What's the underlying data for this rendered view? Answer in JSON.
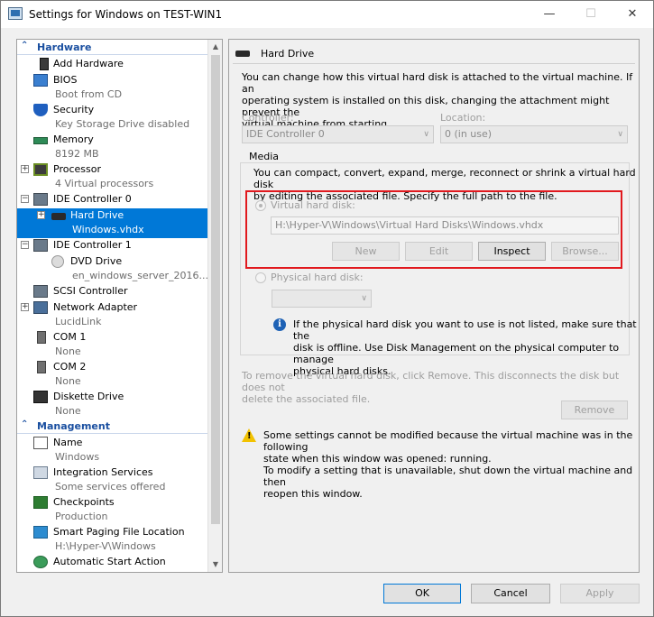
{
  "window": {
    "title": "Settings for Windows on TEST-WIN1",
    "minimize": "—",
    "maximize": "☐",
    "close": "✕"
  },
  "sidebar": {
    "hardware_label": "Hardware",
    "management_label": "Management",
    "items": [
      {
        "name": "Add Hardware",
        "sub": ""
      },
      {
        "name": "BIOS",
        "sub": "Boot from CD"
      },
      {
        "name": "Security",
        "sub": "Key Storage Drive disabled"
      },
      {
        "name": "Memory",
        "sub": "8192 MB"
      },
      {
        "name": "Processor",
        "sub": "4 Virtual processors"
      },
      {
        "name": "IDE Controller 0",
        "sub": ""
      },
      {
        "name": "Hard Drive",
        "sub": "Windows.vhdx"
      },
      {
        "name": "IDE Controller 1",
        "sub": ""
      },
      {
        "name": "DVD Drive",
        "sub": "en_windows_server_2016..."
      },
      {
        "name": "SCSI Controller",
        "sub": ""
      },
      {
        "name": "Network Adapter",
        "sub": "LucidLink"
      },
      {
        "name": "COM 1",
        "sub": "None"
      },
      {
        "name": "COM 2",
        "sub": "None"
      },
      {
        "name": "Diskette Drive",
        "sub": "None"
      }
    ],
    "management_items": [
      {
        "name": "Name",
        "sub": "Windows"
      },
      {
        "name": "Integration Services",
        "sub": "Some services offered"
      },
      {
        "name": "Checkpoints",
        "sub": "Production"
      },
      {
        "name": "Smart Paging File Location",
        "sub": "H:\\Hyper-V\\Windows"
      },
      {
        "name": "Automatic Start Action",
        "sub": ""
      }
    ]
  },
  "main": {
    "header": "Hard Drive",
    "intro": [
      "You can change how this virtual hard disk is attached to the virtual machine. If an",
      "operating system is installed on this disk, changing the attachment might prevent the",
      "virtual machine from starting."
    ],
    "controller_label": "Controller:",
    "controller_value": "IDE Controller 0",
    "location_label": "Location:",
    "location_value": "0 (in use)",
    "media_label": "Media",
    "media_desc": [
      "You can compact, convert, expand, merge, reconnect or shrink a virtual hard disk",
      "by editing the associated file. Specify the full path to the file."
    ],
    "vhd_label": "Virtual hard disk:",
    "vhd_path": "H:\\Hyper-V\\Windows\\Virtual Hard Disks\\Windows.vhdx",
    "new_label": "New",
    "edit_label": "Edit",
    "inspect_label": "Inspect",
    "browse_label": "Browse...",
    "physical_label": "Physical hard disk:",
    "physical_info": [
      "If the physical hard disk you want to use is not listed, make sure that the",
      "disk is offline. Use Disk Management on the physical computer to manage",
      "physical hard disks."
    ],
    "remove_text": [
      "To remove the virtual hard disk, click Remove. This disconnects the disk but does not",
      "delete the associated file."
    ],
    "remove_label": "Remove",
    "warning": [
      "Some settings cannot be modified because the virtual machine was in the following",
      "state when this window was opened: running.",
      "To modify a setting that is unavailable, shut down the virtual machine and then",
      "reopen this window."
    ]
  },
  "footer": {
    "ok_label": "OK",
    "cancel_label": "Cancel",
    "apply_label": "Apply"
  },
  "colors": {
    "accent": "#0078d7",
    "section_header": "#1a4fa0",
    "highlight_border": "#e1191e"
  }
}
